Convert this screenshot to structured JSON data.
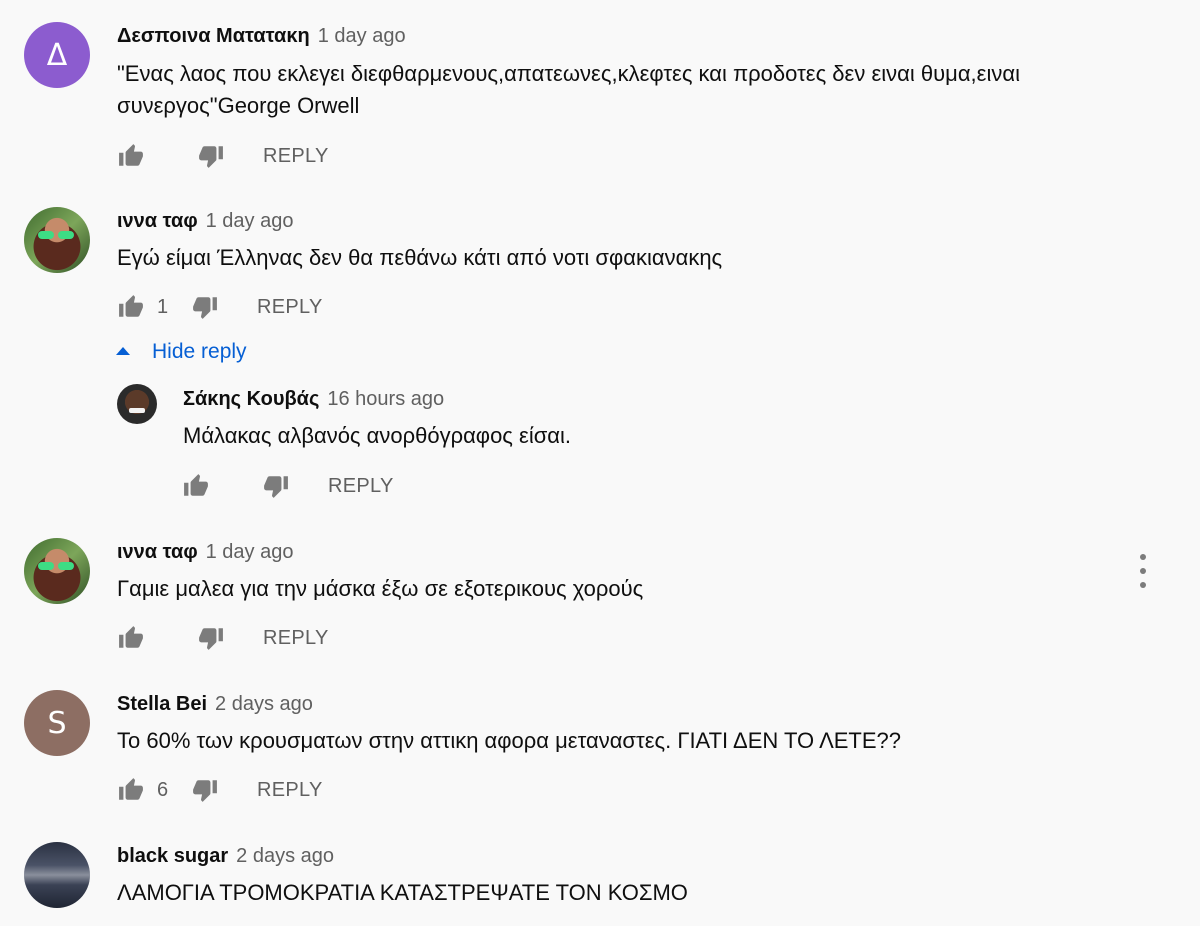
{
  "comments": [
    {
      "author": "Δεσποινα Ματατακη",
      "time": "1 day ago",
      "avatar_letter": "Δ",
      "avatar_color": "#8c5ccf",
      "text_line1": "\"Ενας λαος που εκλεγει διεφθαρμενους,απατεωνες,κλεφτες και προδοτες δεν ειναι θυμα,ειναι",
      "text_line2": "συνεργος\"George Orwell",
      "likes": "",
      "reply_label": "REPLY"
    },
    {
      "author": "ιννα ταφ",
      "time": "1 day ago",
      "text": "Εγώ είμαι Έλληνας δεν θα πεθάνω κάτι από νοτι σφακιανακης",
      "likes": "1",
      "reply_label": "REPLY",
      "hide_replies_label": "Hide reply",
      "replies": [
        {
          "author": "Σάκης Κουβάς",
          "time": "16 hours ago",
          "text": "Μάλακας αλβανός ανορθόγραφος είσαι.",
          "likes": "",
          "reply_label": "REPLY"
        }
      ]
    },
    {
      "author": "ιννα ταφ",
      "time": "1 day ago",
      "text": "Γαμιε μαλεα για την μάσκα έξω σε εξοτερικους χορούς",
      "likes": "",
      "reply_label": "REPLY"
    },
    {
      "author": "Stella Bei",
      "time": "2 days ago",
      "avatar_letter": "S",
      "avatar_color": "#8d6e63",
      "text": "Το 60% των κρουσματων στην αττικη αφορα μεταναστες. ΓΙΑΤΙ ΔΕΝ ΤΟ ΛΕΤΕ??",
      "likes": "6",
      "reply_label": "REPLY"
    },
    {
      "author": "black sugar",
      "time": "2 days ago",
      "text": "ΛΑΜΟΓΙΑ  ΤΡΟΜΟΚΡΑΤΙΑ ΚΑΤΑΣΤΡΕΨΑΤΕ ΤΟΝ ΚΟΣΜΟ"
    }
  ],
  "icons": {
    "like": "thumb-up-icon",
    "dislike": "thumb-down-icon",
    "menu": "more-vert-icon",
    "collapse": "caret-up-icon"
  }
}
